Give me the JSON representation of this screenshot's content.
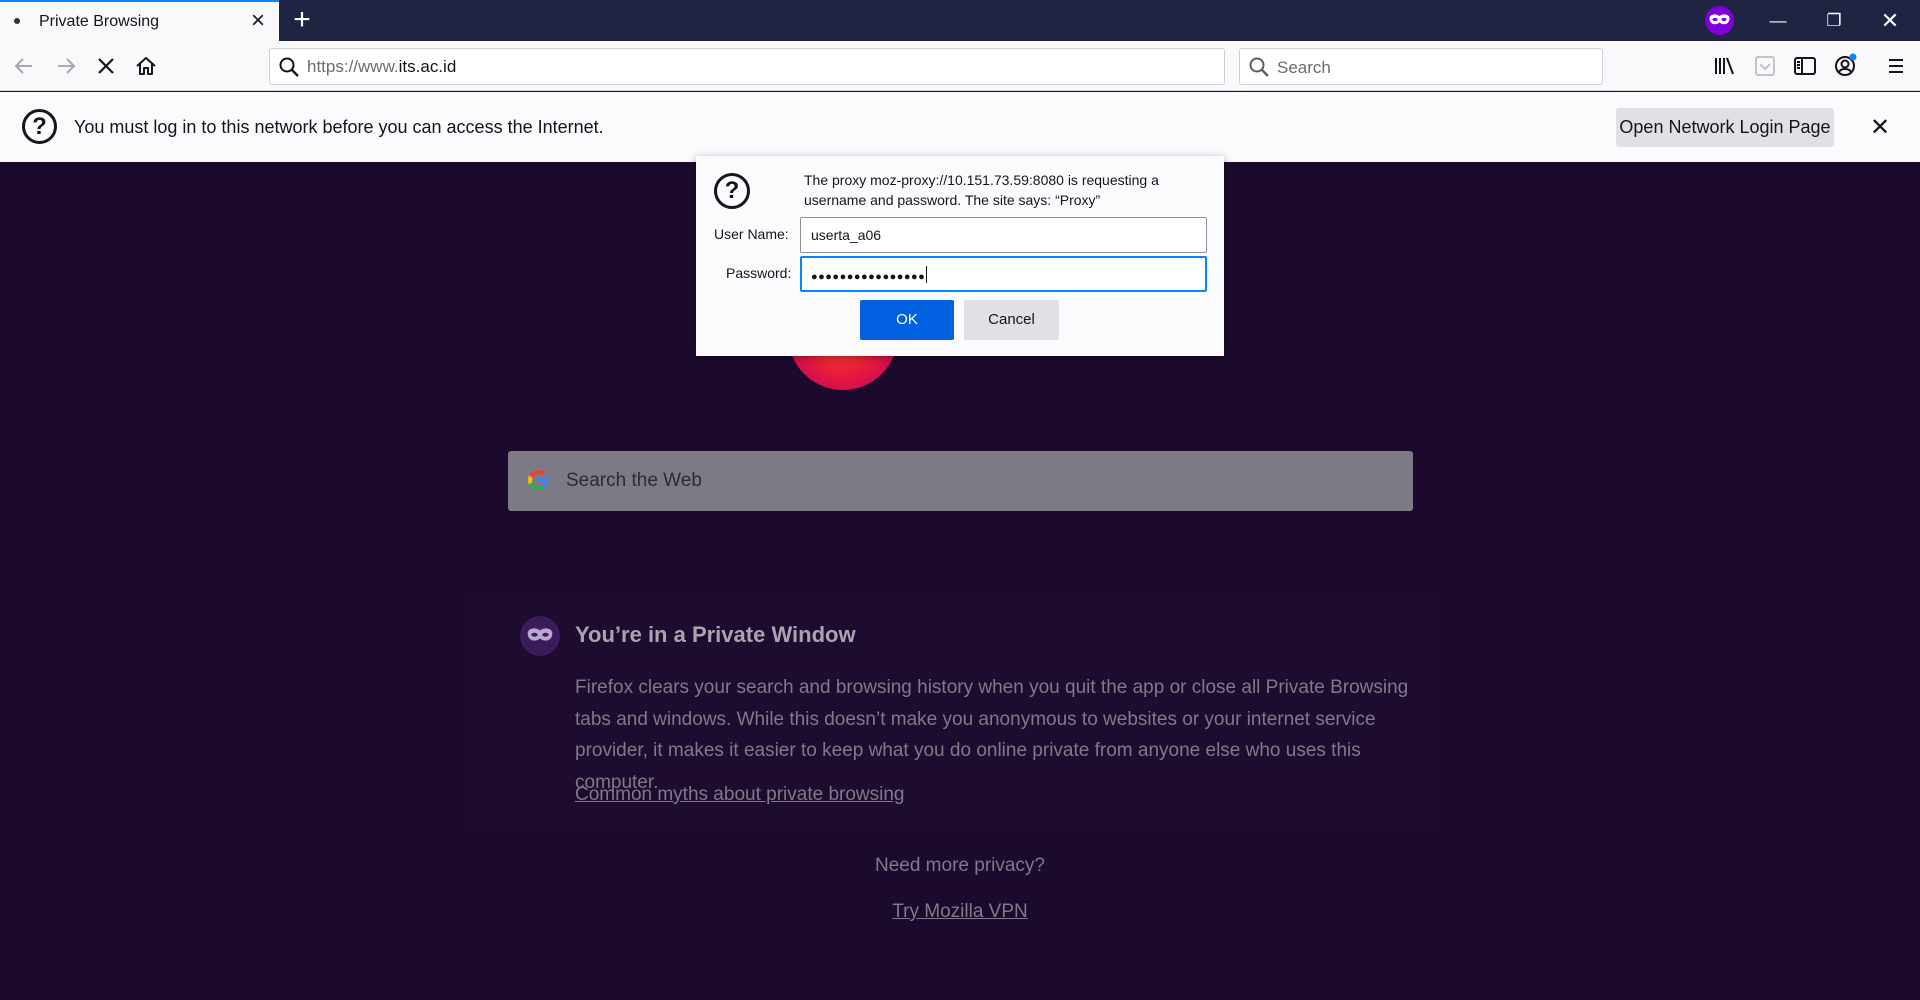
{
  "tab": {
    "title": "Private Browsing"
  },
  "address_bar": {
    "url_prefix": "https://www.",
    "url_domain": "its.ac.id"
  },
  "search_bar": {
    "placeholder": "Search"
  },
  "notification": {
    "message": "You must log in to this network before you can access the Internet.",
    "button_label": "Open Network Login Page"
  },
  "dialog": {
    "message": "The proxy moz-proxy://10.151.73.59:8080 is requesting a username and password. The site says: “Proxy”",
    "username_label": "User Name:",
    "username_value": "userta_a06",
    "password_label": "Password:",
    "password_value": "●●●●●●●●●●●●●●●●",
    "ok_label": "OK",
    "cancel_label": "Cancel"
  },
  "page": {
    "web_search_placeholder": "Search the Web",
    "private_title": "You’re in a Private Window",
    "private_body": "Firefox clears your search and browsing history when you quit the app or close all Private Browsing tabs and windows. While this doesn’t make you anonymous to websites or your internet service provider, it makes it easier to keep what you do online private from anyone else who uses this computer.",
    "myths_link": "Common myths about private browsing",
    "vpn_question": "Need more privacy?",
    "vpn_link": "Try Mozilla VPN"
  },
  "colors": {
    "accent": "#0a84ff",
    "primary_button": "#0060df",
    "private_purple": "#8000d7",
    "page_background": "#1c0a2e"
  },
  "icons": [
    "back-icon",
    "forward-icon",
    "stop-icon",
    "home-icon",
    "search-icon",
    "library-icon",
    "pocket-icon",
    "sidebar-icon",
    "account-icon",
    "menu-icon",
    "private-mask-icon",
    "google-icon",
    "question-icon",
    "close-icon",
    "plus-icon",
    "minimize-icon",
    "restore-icon"
  ]
}
